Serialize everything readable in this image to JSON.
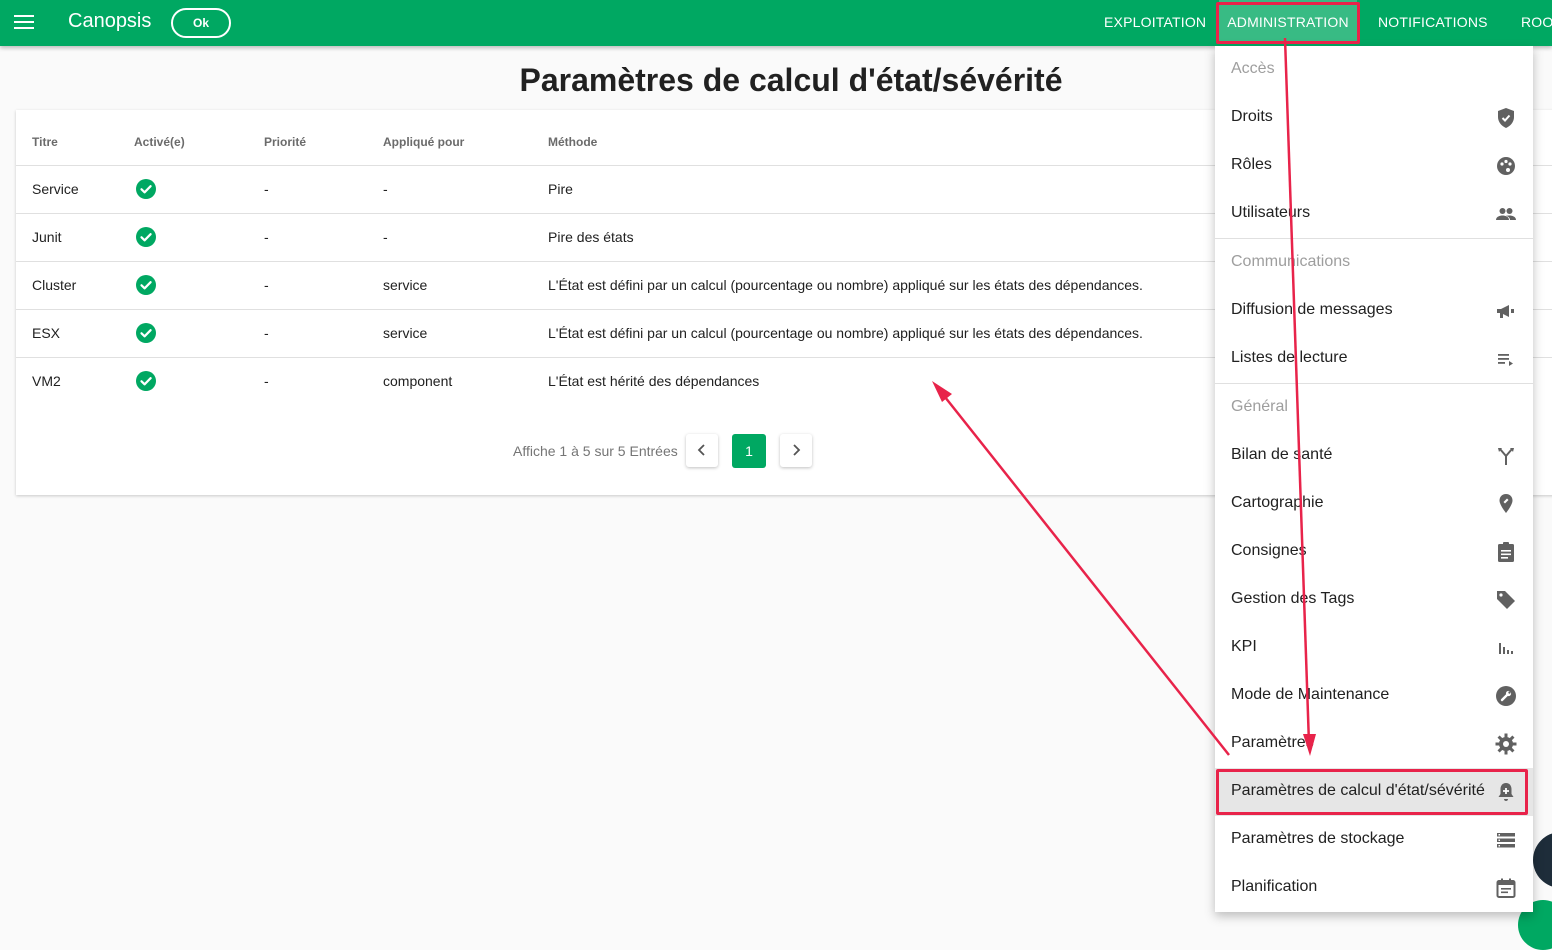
{
  "app": {
    "title": "Canopsis",
    "status_chip": "Ok"
  },
  "nav": {
    "exploitation": "EXPLOITATION",
    "administration": "ADMINISTRATION",
    "notifications": "NOTIFICATIONS",
    "root": "ROOT"
  },
  "page": {
    "title": "Paramètres de calcul d'état/sévérité"
  },
  "table": {
    "headers": {
      "titre": "Titre",
      "active": "Activé(e)",
      "priorite": "Priorité",
      "applique": "Appliqué pour",
      "methode": "Méthode"
    },
    "rows": [
      {
        "titre": "Service",
        "priorite": "-",
        "applique": "-",
        "methode": "Pire"
      },
      {
        "titre": "Junit",
        "priorite": "-",
        "applique": "-",
        "methode": "Pire des états"
      },
      {
        "titre": "Cluster",
        "priorite": "-",
        "applique": "service",
        "methode": "L'État est défini par un calcul (pourcentage ou nombre) appliqué sur les états des dépendances."
      },
      {
        "titre": "ESX",
        "priorite": "-",
        "applique": "service",
        "methode": "L'État est défini par un calcul (pourcentage ou nombre) appliqué sur les états des dépendances."
      },
      {
        "titre": "VM2",
        "priorite": "-",
        "applique": "component",
        "methode": "L'État est hérité des dépendances"
      }
    ],
    "pagination": {
      "summary": "Affiche 1 à 5 sur 5 Entrées",
      "current_page": "1"
    }
  },
  "menu": {
    "acces": {
      "header": "Accès",
      "items": [
        {
          "label": "Droits",
          "icon": "shield-check-icon"
        },
        {
          "label": "Rôles",
          "icon": "palette-icon"
        },
        {
          "label": "Utilisateurs",
          "icon": "people-icon"
        }
      ]
    },
    "communications": {
      "header": "Communications",
      "items": [
        {
          "label": "Diffusion de messages",
          "icon": "megaphone-icon"
        },
        {
          "label": "Listes de lecture",
          "icon": "playlist-icon"
        }
      ]
    },
    "general": {
      "header": "Général",
      "items": [
        {
          "label": "Bilan de santé",
          "icon": "fork-icon"
        },
        {
          "label": "Cartographie",
          "icon": "map-pin-icon"
        },
        {
          "label": "Consignes",
          "icon": "clipboard-icon"
        },
        {
          "label": "Gestion des Tags",
          "icon": "tag-icon"
        },
        {
          "label": "KPI",
          "icon": "bar-chart-icon"
        },
        {
          "label": "Mode de Maintenance",
          "icon": "wrench-icon"
        },
        {
          "label": "Paramètres",
          "icon": "gear-icon"
        },
        {
          "label": "Paramètres de calcul d'état/sévérité",
          "icon": "bell-plus-icon"
        },
        {
          "label": "Paramètres de stockage",
          "icon": "storage-icon"
        },
        {
          "label": "Planification",
          "icon": "calendar-icon"
        }
      ]
    }
  },
  "colors": {
    "primary": "#00a862",
    "annotation": "#e8234a"
  }
}
